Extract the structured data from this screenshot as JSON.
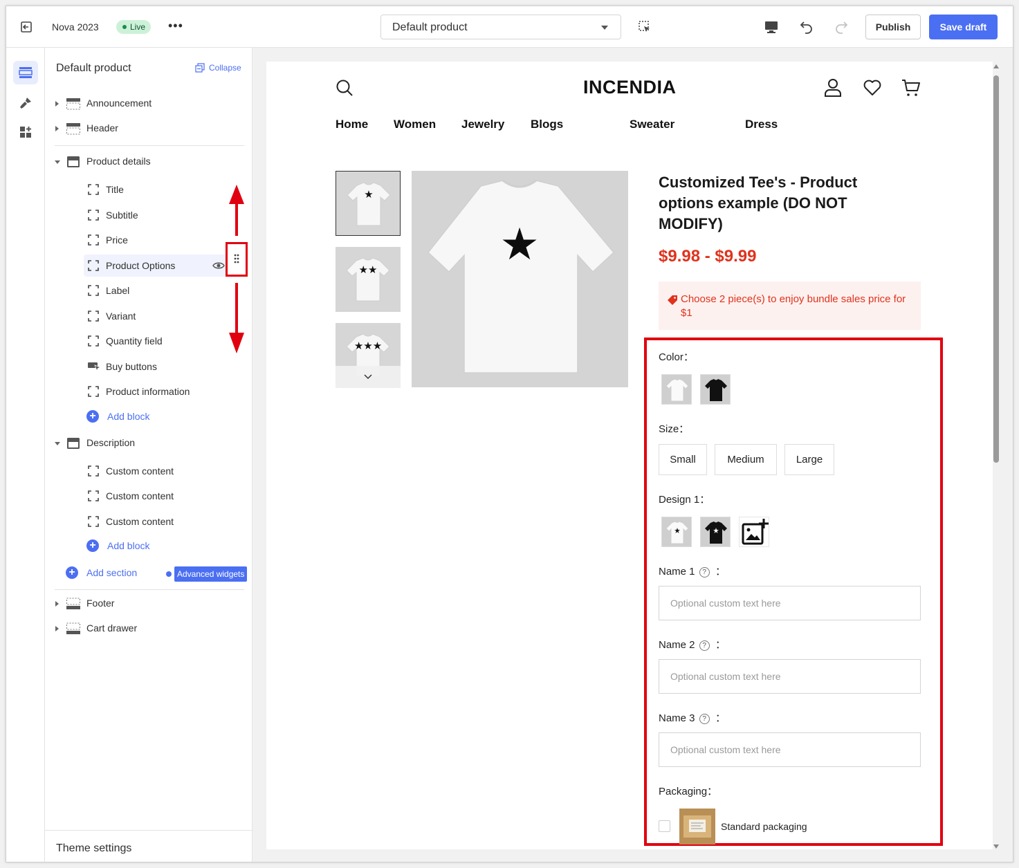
{
  "topbar": {
    "store_name": "Nova 2023",
    "status": "Live",
    "more": "•••",
    "template": "Default product",
    "publish_label": "Publish",
    "save_label": "Save draft"
  },
  "sidebar": {
    "title": "Default product",
    "collapse_label": "Collapse",
    "sections": {
      "announcement": "Announcement",
      "header": "Header",
      "product_details": "Product details",
      "description": "Description",
      "footer": "Footer",
      "cart_drawer": "Cart drawer"
    },
    "product_blocks": [
      "Title",
      "Subtitle",
      "Price",
      "Product Options",
      "Label",
      "Variant",
      "Quantity field",
      "Buy buttons",
      "Product information"
    ],
    "description_blocks": [
      "Custom content",
      "Custom content",
      "Custom content"
    ],
    "add_block": "Add block",
    "add_section": "Add section",
    "advanced_widgets": "Advanced widgets",
    "theme_settings": "Theme settings"
  },
  "store": {
    "logo": "INCENDIA",
    "nav": [
      "Home",
      "Women",
      "Jewelry",
      "Blogs",
      "Sweater",
      "Dress"
    ]
  },
  "product": {
    "title": "Customized Tee's - Product options example (DO NOT MODIFY)",
    "price": "$9.98 - $9.99",
    "bundle_text": "Choose 2 piece(s) to enjoy bundle sales price for $1",
    "thumb_stars": [
      "★",
      "★★",
      "★★★"
    ],
    "main_star": "★"
  },
  "options": {
    "color_label": "Color：",
    "size_label": "Size：",
    "sizes": [
      "Small",
      "Medium",
      "Large"
    ],
    "design_label": "Design 1：",
    "name1_label": "Name 1",
    "name2_label": "Name 2",
    "name3_label": "Name 3",
    "name_suffix": "：",
    "placeholder": "Optional custom text here",
    "packaging_label": "Packaging：",
    "packaging_option": "Standard packaging"
  },
  "colors": {
    "accent": "#4b6ff2",
    "price": "#e0321d",
    "annotation": "#e1000f",
    "live_bg": "#cdf1d8"
  }
}
